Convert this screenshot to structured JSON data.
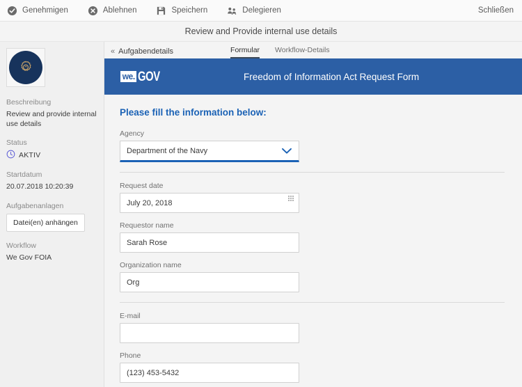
{
  "toolbar": {
    "actions": [
      {
        "label": "Genehmigen",
        "icon": "check-circle-icon"
      },
      {
        "label": "Ablehnen",
        "icon": "x-circle-icon"
      },
      {
        "label": "Speichern",
        "icon": "save-floppy-icon"
      },
      {
        "label": "Delegieren",
        "icon": "delegate-users-icon"
      }
    ],
    "close_label": "Schließen"
  },
  "titlebar": {
    "title": "Review and Provide internal use details"
  },
  "sidebar": {
    "avatar_icon": "gear-badge-icon",
    "description_label": "Beschreibung",
    "description_value": "Review and provide internal use details",
    "status_label": "Status",
    "status_value": "AKTIV",
    "status_icon": "clock-icon",
    "status_color": "#5a5ad6",
    "startdate_label": "Startdatum",
    "startdate_value": "20.07.2018 10:20:39",
    "attachments_label": "Aufgabenanlagen",
    "attach_button_label": "Datei(en) anhängen",
    "workflow_label": "Workflow",
    "workflow_value": "We Gov FOIA"
  },
  "tabbar": {
    "back_label": "Aufgabendetails",
    "back_icon": "double-chevron-left-icon",
    "tabs": [
      {
        "label": "Formular",
        "active": true
      },
      {
        "label": "Workflow-Details",
        "active": false
      }
    ]
  },
  "form": {
    "banner": {
      "logo_we": "we.",
      "logo_gov": "GOV",
      "title": "Freedom of Information Act Request Form",
      "color": "#2c5fa5"
    },
    "heading": "Please fill the information below:",
    "heading_color": "#1b62b5",
    "fields": [
      {
        "label": "Agency",
        "value": "Department of the Navy",
        "placeholder": "",
        "type": "select",
        "icon": "chevron-down-icon",
        "focused": true
      },
      {
        "label": "Request date",
        "value": "July 20, 2018",
        "placeholder": "",
        "type": "date",
        "icon": "calendar-grid-icon",
        "focused": false
      },
      {
        "label": "Requestor name",
        "value": "Sarah Rose",
        "placeholder": "",
        "type": "text",
        "icon": "",
        "focused": false
      },
      {
        "label": "Organization name",
        "value": "Org",
        "placeholder": "",
        "type": "text",
        "icon": "",
        "focused": false
      },
      {
        "label": "E-mail",
        "value": "",
        "placeholder": "",
        "type": "email",
        "icon": "",
        "focused": false
      },
      {
        "label": "Phone",
        "value": "(123) 453-5432",
        "placeholder": "",
        "type": "tel",
        "icon": "",
        "focused": false
      }
    ]
  }
}
